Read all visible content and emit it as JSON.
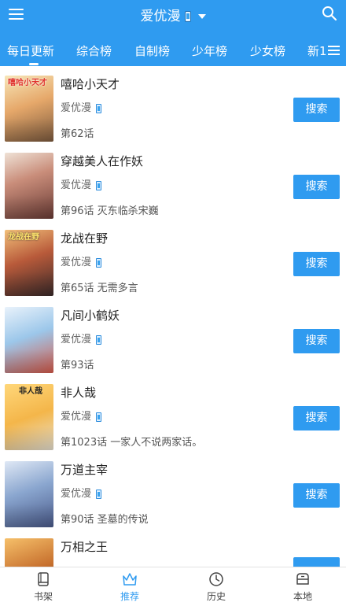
{
  "app": {
    "title": "爱优漫",
    "accent": "#2f9bf0"
  },
  "header": {
    "menu_icon": "menu-icon",
    "search_icon": "search-icon",
    "dropdown_icon": "caret-down-icon"
  },
  "tabs": [
    "每日更新",
    "综合榜",
    "自制榜",
    "少年榜",
    "少女榜",
    "新1"
  ],
  "active_tab": "每日更新",
  "comics": [
    {
      "title": "嘻哈小天才",
      "source": "爱优漫",
      "chapter": "第62话",
      "cover_text": "嘻哈小天才",
      "button": "搜索"
    },
    {
      "title": "穿越美人在作妖",
      "source": "爱优漫",
      "chapter": "第96话 灭东临杀宋巍",
      "cover_text": "",
      "button": "搜索"
    },
    {
      "title": "龙战在野",
      "source": "爱优漫",
      "chapter": "第65话 无需多言",
      "cover_text": "龙战在野",
      "button": "搜索"
    },
    {
      "title": "凡间小鹤妖",
      "source": "爱优漫",
      "chapter": "第93话",
      "cover_text": "",
      "button": "搜索"
    },
    {
      "title": "非人哉",
      "source": "爱优漫",
      "chapter": "第1023话 一家人不说两家话。",
      "cover_text": "非人哉",
      "button": "搜索"
    },
    {
      "title": "万道主宰",
      "source": "爱优漫",
      "chapter": "第90话 圣墓的传说",
      "cover_text": "",
      "button": "搜索"
    },
    {
      "title": "万相之王",
      "source": "",
      "chapter": "",
      "cover_text": "",
      "button": ""
    }
  ],
  "bottom_nav": [
    {
      "label": "书架",
      "icon": "bookshelf-icon"
    },
    {
      "label": "推荐",
      "icon": "crown-icon"
    },
    {
      "label": "历史",
      "icon": "clock-icon"
    },
    {
      "label": "本地",
      "icon": "local-storage-icon"
    }
  ],
  "active_nav": "推荐"
}
